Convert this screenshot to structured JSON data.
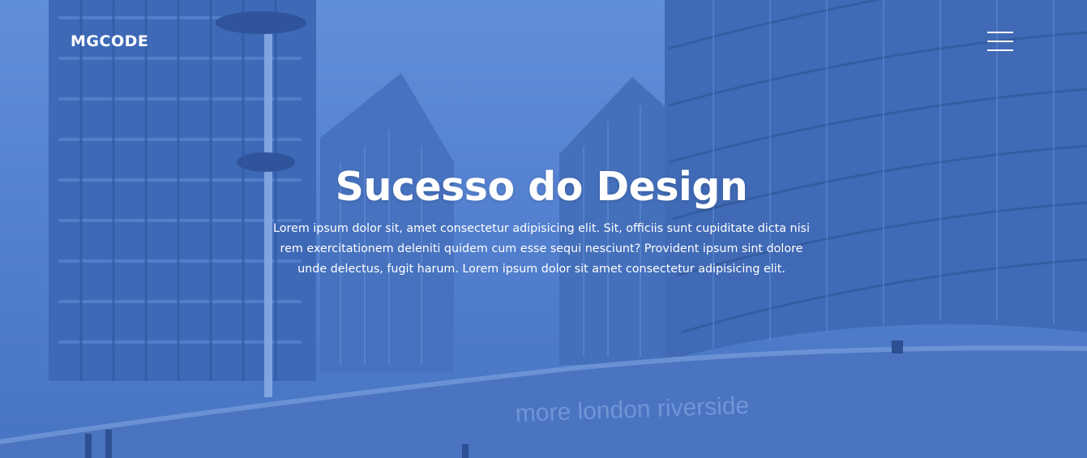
{
  "navbar": {
    "logo": "MGCODE",
    "menu_icon": "hamburger-menu-icon"
  },
  "hero": {
    "title": "Sucesso do Design",
    "text": "Lorem ipsum dolor sit, amet consectetur adipisicing elit. Sit, officiis sunt cupiditate dicta nisi rem exercitationem deleniti quidem cum esse sequi nesciunt? Provident ipsum sint dolore unde delectus, fugit harum. Lorem ipsum dolor sit amet consectetur adipisicing elit.",
    "background_sign": "more london riverside"
  },
  "colors": {
    "overlay_blue": "#5a86d2",
    "text": "#ffffff"
  }
}
